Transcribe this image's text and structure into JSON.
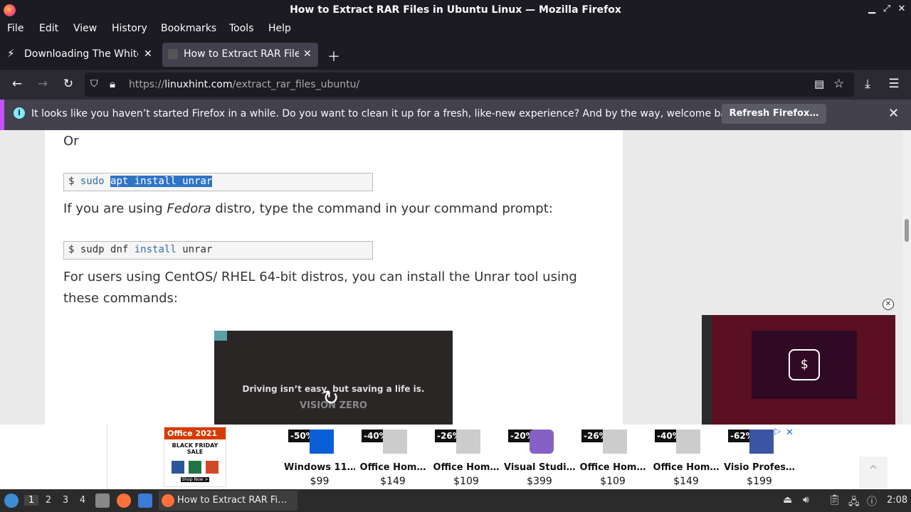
{
  "window": {
    "title": "How to Extract RAR Files in Ubuntu Linux — Mozilla Firefox"
  },
  "menu": [
    "File",
    "Edit",
    "View",
    "History",
    "Bookmarks",
    "Tools",
    "Help"
  ],
  "tabs": [
    {
      "label": "Downloading The White H",
      "active": false
    },
    {
      "label": "How to Extract RAR Files",
      "active": true
    }
  ],
  "nav": {
    "url_prefix": "https://",
    "url_host": "linuxhint.com",
    "url_path": "/extract_rar_files_ubuntu/"
  },
  "notification": {
    "message": "It looks like you haven’t started Firefox in a while. Do you want to clean it up for a fresh, like-new experience? And by the way, welcome back!",
    "button": "Refresh Firefox…"
  },
  "article": {
    "or": "Or",
    "cmd1": {
      "prompt": "$",
      "cmd": "sudo",
      "selected": "apt install unrar"
    },
    "para1_before": "If you are using ",
    "para1_em": "Fedora",
    "para1_after": " distro, type the command in your command prompt:",
    "cmd2": {
      "prompt": "$",
      "cmd": "sudp dnf",
      "kw": "install",
      "arg": "unrar"
    },
    "para2": "For users using CentOS/ RHEL 64-bit distros, you can install the Unrar tool using these commands:",
    "video_caption": "Driving isn’t easy, but saving a life is.",
    "video_brand": "VISION ZERO"
  },
  "ad": {
    "office_title": "Office 2021",
    "office_sale": "BLACK FRIDAY SALE",
    "office_shop": "Shop Now >",
    "products": [
      {
        "discount": "-50%",
        "name": "Windows 11…",
        "price": "$99",
        "icon": "windows-icon"
      },
      {
        "discount": "-40%",
        "name": "Office Hom…",
        "price": "$149",
        "icon": "office-box-icon"
      },
      {
        "discount": "-26%",
        "name": "Office Hom…",
        "price": "$109",
        "icon": "office-box-icon"
      },
      {
        "discount": "-20%",
        "name": "Visual Studi…",
        "price": "$399",
        "icon": "visual-studio-icon"
      },
      {
        "discount": "-26%",
        "name": "Office Hom…",
        "price": "$109",
        "icon": "office-box-icon"
      },
      {
        "discount": "-40%",
        "name": "Office Hom…",
        "price": "$149",
        "icon": "office-box-icon"
      },
      {
        "discount": "-62%",
        "name": "Visio Profes…",
        "price": "$199",
        "icon": "visio-icon"
      }
    ]
  },
  "taskbar": {
    "workspaces": [
      "1",
      "2",
      "3",
      "4"
    ],
    "active_window": "How to Extract RAR Fi…",
    "clock": "2:08"
  }
}
